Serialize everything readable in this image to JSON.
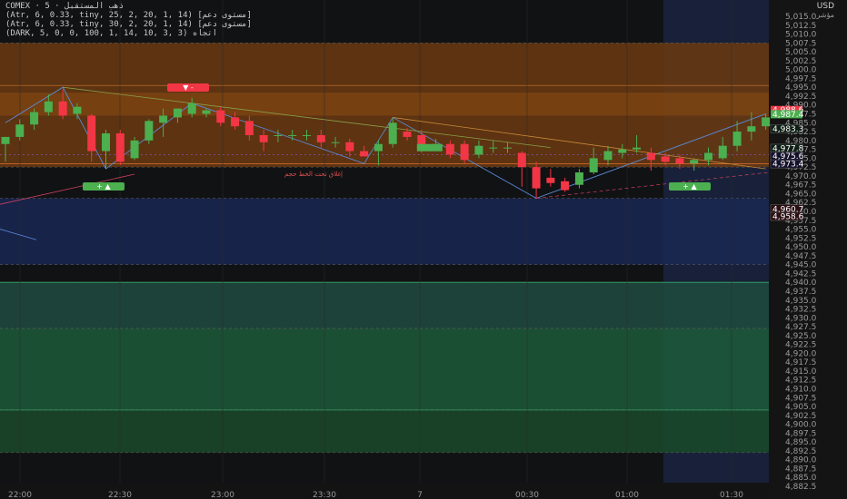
{
  "header": {
    "symbol_line": "COMEX · 5 · ذهب المستقبل",
    "indicator_lines": [
      "(Atr, 6, 0.33, tiny, 25, 2, 20, 1, 14) [مستوى دعم]",
      "(Atr, 6, 0.33, tiny, 30, 2, 20, 1, 14) [مستوى دعم]",
      "(DARK, 5, 0, 0, 100, 1, 14, 10, 3, 3) اتجاه"
    ],
    "currency": "USD",
    "currency_sub": "مؤشر"
  },
  "annotations": {
    "note_text": "إغلاق تحت الخط حجم",
    "buy_label_1": "+ ▲",
    "buy_label_2": "+ ▲",
    "sell_label": "▼ -"
  },
  "colors": {
    "up": "#4caf50",
    "down": "#f23645",
    "orange_zone": "#6b3a10",
    "blue_zone": "#1a2752",
    "green_zone_1": "#1e4b3f",
    "green_zone_2": "#1d5a3a",
    "green_zone_3": "#1a4a2a"
  },
  "chart_data": {
    "type": "candlestick",
    "y_ticks": [
      "5,015.0",
      "5,012.5",
      "5,010.0",
      "5,007.5",
      "5,005.0",
      "5,002.5",
      "5,000.0",
      "4,997.5",
      "4,995.0",
      "4,992.5",
      "4,990.0",
      "4,987.5",
      "4,985.0",
      "4,982.5",
      "4,980.0",
      "4,977.5",
      "4,975.0",
      "4,972.5",
      "4,970.0",
      "4,967.5",
      "4,965.0",
      "4,962.5",
      "4,960.0",
      "4,957.5",
      "4,955.0",
      "4,952.5",
      "4,950.0",
      "4,947.5",
      "4,945.0",
      "4,942.5",
      "4,940.0",
      "4,937.5",
      "4,935.0",
      "4,932.5",
      "4,930.0",
      "4,927.5",
      "4,925.0",
      "4,922.5",
      "4,920.0",
      "4,917.5",
      "4,915.0",
      "4,912.5",
      "4,910.0",
      "4,907.5",
      "4,905.0",
      "4,902.5",
      "4,900.0",
      "4,897.5",
      "4,895.0",
      "4,892.5",
      "4,890.0",
      "4,887.5",
      "4,885.0",
      "4,882.5"
    ],
    "x_ticks": [
      "22:00",
      "22:30",
      "23:00",
      "23:30",
      "7",
      "00:30",
      "01:00",
      "01:30"
    ],
    "ylim": [
      4882.5,
      5016
    ],
    "price_labels": [
      {
        "value": 4988.6,
        "text": "4,988.6",
        "color": "#f23645"
      },
      {
        "value": 4987.4,
        "text": "4,987.4",
        "color": "#4caf50"
      },
      {
        "value": 4983.3,
        "text": "4,983.3",
        "color": "#0e1e14"
      },
      {
        "value": 4977.8,
        "text": "4,977.8",
        "color": "#0e1e14"
      },
      {
        "value": 4975.6,
        "text": "4,975.6",
        "color": "#14102a"
      },
      {
        "value": 4973.4,
        "text": "4,973.4",
        "color": "#14102a"
      },
      {
        "value": 4960.7,
        "text": "4,960.7",
        "color": "#2a0e12"
      },
      {
        "value": 4958.6,
        "text": "4,958.6",
        "color": "#2a0e12"
      }
    ],
    "zones": [
      {
        "from": 4972.5,
        "to": 5007.5,
        "color": "orange"
      },
      {
        "from": 4945.0,
        "to": 4963.7,
        "color": "blue"
      },
      {
        "from": 4927.0,
        "to": 4940.0,
        "color": "green1"
      },
      {
        "from": 4904.0,
        "to": 4927.0,
        "color": "green2"
      },
      {
        "from": 4892.0,
        "to": 4904.0,
        "color": "green3"
      }
    ],
    "candles": [
      {
        "o": 4979.0,
        "h": 4981.0,
        "l": 4974.0,
        "c": 4981.0
      },
      {
        "o": 4981.0,
        "h": 4986.0,
        "l": 4980.0,
        "c": 4984.5
      },
      {
        "o": 4984.5,
        "h": 4989.0,
        "l": 4983.0,
        "c": 4988.0
      },
      {
        "o": 4988.0,
        "h": 4993.0,
        "l": 4987.0,
        "c": 4991.0
      },
      {
        "o": 4991.0,
        "h": 4994.5,
        "l": 4986.0,
        "c": 4987.0
      },
      {
        "o": 4987.5,
        "h": 4990.5,
        "l": 4986.0,
        "c": 4989.5
      },
      {
        "o": 4987.0,
        "h": 4987.5,
        "l": 4974.0,
        "c": 4977.0
      },
      {
        "o": 4977.0,
        "h": 4983.0,
        "l": 4972.0,
        "c": 4982.0
      },
      {
        "o": 4982.0,
        "h": 4983.0,
        "l": 4973.0,
        "c": 4974.0
      },
      {
        "o": 4975.0,
        "h": 4981.0,
        "l": 4974.5,
        "c": 4980.0
      },
      {
        "o": 4980.0,
        "h": 4986.0,
        "l": 4979.0,
        "c": 4985.5
      },
      {
        "o": 4985.0,
        "h": 4989.0,
        "l": 4981.0,
        "c": 4987.0
      },
      {
        "o": 4986.5,
        "h": 4989.0,
        "l": 4985.0,
        "c": 4989.0
      },
      {
        "o": 4987.5,
        "h": 4992.0,
        "l": 4986.5,
        "c": 4990.5
      },
      {
        "o": 4987.5,
        "h": 4989.0,
        "l": 4986.5,
        "c": 4988.5
      },
      {
        "o": 4988.5,
        "h": 4989.5,
        "l": 4984.0,
        "c": 4985.0
      },
      {
        "o": 4986.5,
        "h": 4988.0,
        "l": 4983.0,
        "c": 4984.0
      },
      {
        "o": 4985.5,
        "h": 4987.0,
        "l": 4980.0,
        "c": 4981.5
      },
      {
        "o": 4981.5,
        "h": 4983.0,
        "l": 4977.0,
        "c": 4979.5
      },
      {
        "o": 4981.5,
        "h": 4983.0,
        "l": 4979.5,
        "c": 4981.5
      },
      {
        "o": 4981.5,
        "h": 4983.0,
        "l": 4980.0,
        "c": 4981.5
      },
      {
        "o": 4981.5,
        "h": 4983.0,
        "l": 4980.0,
        "c": 4981.5
      },
      {
        "o": 4981.5,
        "h": 4983.0,
        "l": 4978.0,
        "c": 4979.5
      },
      {
        "o": 4979.5,
        "h": 4981.0,
        "l": 4978.0,
        "c": 4979.5
      },
      {
        "o": 4979.5,
        "h": 4980.5,
        "l": 4975.5,
        "c": 4977.0
      },
      {
        "o": 4977.0,
        "h": 4978.5,
        "l": 4975.5,
        "c": 4975.5
      },
      {
        "o": 4977.0,
        "h": 4980.0,
        "l": 4973.0,
        "c": 4979.0
      },
      {
        "o": 4979.0,
        "h": 4986.5,
        "l": 4978.0,
        "c": 4985.0
      },
      {
        "o": 4982.5,
        "h": 4983.5,
        "l": 4980.0,
        "c": 4981.0
      },
      {
        "o": 4981.5,
        "h": 4983.0,
        "l": 4976.5,
        "c": 4978.5
      },
      {
        "o": 4979.0,
        "h": 4980.5,
        "l": 4977.5,
        "c": 4979.0
      },
      {
        "o": 4979.0,
        "h": 4980.0,
        "l": 4975.0,
        "c": 4976.0
      },
      {
        "o": 4979.0,
        "h": 4980.0,
        "l": 4973.5,
        "c": 4974.5
      },
      {
        "o": 4976.0,
        "h": 4980.0,
        "l": 4975.0,
        "c": 4978.5
      },
      {
        "o": 4978.0,
        "h": 4980.0,
        "l": 4976.5,
        "c": 4978.0
      },
      {
        "o": 4978.0,
        "h": 4979.5,
        "l": 4976.5,
        "c": 4978.0
      },
      {
        "o": 4976.5,
        "h": 4977.0,
        "l": 4967.0,
        "c": 4972.5
      },
      {
        "o": 4972.5,
        "h": 4974.0,
        "l": 4963.7,
        "c": 4966.5
      },
      {
        "o": 4969.5,
        "h": 4972.0,
        "l": 4967.0,
        "c": 4968.0
      },
      {
        "o": 4968.5,
        "h": 4969.5,
        "l": 4965.5,
        "c": 4966.0
      },
      {
        "o": 4967.5,
        "h": 4972.0,
        "l": 4966.5,
        "c": 4971.0
      },
      {
        "o": 4971.0,
        "h": 4978.0,
        "l": 4970.5,
        "c": 4975.0
      },
      {
        "o": 4974.5,
        "h": 4978.5,
        "l": 4973.0,
        "c": 4977.0
      },
      {
        "o": 4976.5,
        "h": 4979.0,
        "l": 4975.0,
        "c": 4977.5
      },
      {
        "o": 4977.5,
        "h": 4981.5,
        "l": 4976.5,
        "c": 4978.0
      },
      {
        "o": 4976.5,
        "h": 4978.0,
        "l": 4971.5,
        "c": 4974.5
      },
      {
        "o": 4975.5,
        "h": 4976.5,
        "l": 4973.0,
        "c": 4974.0
      },
      {
        "o": 4975.0,
        "h": 4976.0,
        "l": 4972.0,
        "c": 4973.5
      },
      {
        "o": 4973.5,
        "h": 4975.0,
        "l": 4971.5,
        "c": 4974.5
      },
      {
        "o": 4974.5,
        "h": 4978.0,
        "l": 4973.0,
        "c": 4976.5
      },
      {
        "o": 4975.0,
        "h": 4981.0,
        "l": 4974.5,
        "c": 4978.5
      },
      {
        "o": 4978.5,
        "h": 4985.5,
        "l": 4977.0,
        "c": 4982.5
      },
      {
        "o": 4982.5,
        "h": 4988.0,
        "l": 4980.0,
        "c": 4984.0
      },
      {
        "o": 4984.0,
        "h": 4987.5,
        "l": 4983.0,
        "c": 4986.5
      }
    ]
  }
}
